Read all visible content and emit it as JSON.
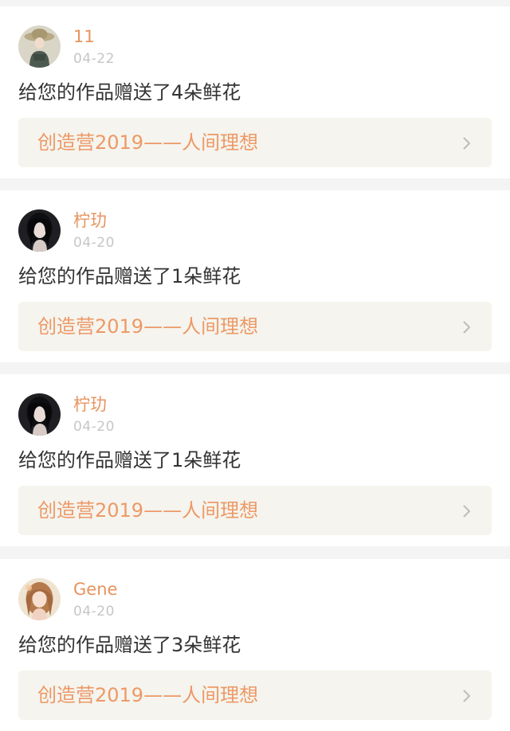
{
  "feed": {
    "items": [
      {
        "username": "11",
        "date": "04-22",
        "message": "给您的作品赠送了4朵鲜花",
        "work_title": "创造营2019——人间理想",
        "avatar_icon": "avatar-girl-hat-icon"
      },
      {
        "username": "柠玏",
        "date": "04-20",
        "message": "给您的作品赠送了1朵鲜花",
        "work_title": "创造营2019——人间理想",
        "avatar_icon": "avatar-dark-hair-icon"
      },
      {
        "username": "柠玏",
        "date": "04-20",
        "message": "给您的作品赠送了1朵鲜花",
        "work_title": "创造营2019——人间理想",
        "avatar_icon": "avatar-dark-hair-icon"
      },
      {
        "username": "Gene",
        "date": "04-20",
        "message": "给您的作品赠送了3朵鲜花",
        "work_title": "创造营2019——人间理想",
        "avatar_icon": "avatar-light-hair-icon"
      }
    ]
  },
  "colors": {
    "page_background": "#f4f4f4",
    "card_background": "#ffffff",
    "username": "#e8935e",
    "date": "#c6c6c6",
    "message": "#333333",
    "link_background": "#f5f4ee",
    "link_text": "#ed9966",
    "chevron": "#bdbdbd"
  }
}
